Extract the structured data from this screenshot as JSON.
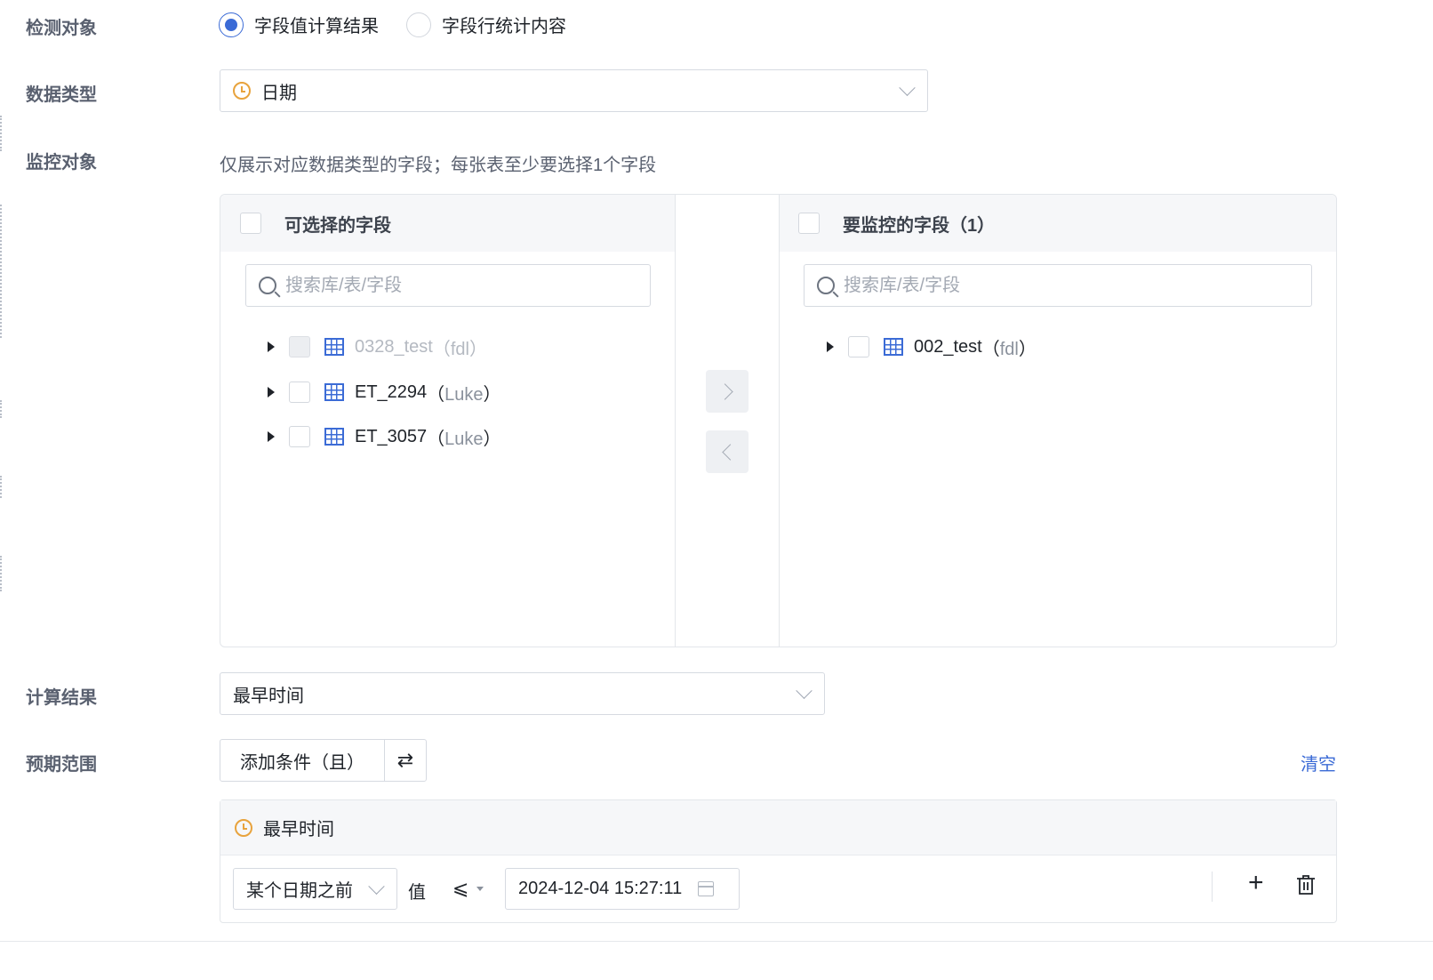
{
  "labels": {
    "detect_target": "检测对象",
    "data_type": "数据类型",
    "monitor_target": "监控对象",
    "calc_result": "计算结果",
    "expected_range": "预期范围"
  },
  "detect_options": [
    {
      "label": "字段值计算结果",
      "selected": true
    },
    {
      "label": "字段行统计内容",
      "selected": false
    }
  ],
  "data_type": {
    "value": "日期",
    "icon": "clock-icon"
  },
  "monitor": {
    "hint": "仅展示对应数据类型的字段；每张表至少要选择1个字段",
    "left_panel": {
      "title": "可选择的字段",
      "search_placeholder": "搜索库/表/字段",
      "items": [
        {
          "name": "0328_test",
          "owner_open": "（",
          "owner": "fdl",
          "owner_close": "）",
          "disabled": true
        },
        {
          "name": "ET_2294",
          "owner_open": "（",
          "owner": "Luke",
          "owner_close": "）",
          "disabled": false
        },
        {
          "name": "ET_3057",
          "owner_open": "（",
          "owner": "Luke",
          "owner_close": "）",
          "disabled": false
        }
      ]
    },
    "right_panel": {
      "title": "要监控的字段（1）",
      "search_placeholder": "搜索库/表/字段",
      "items": [
        {
          "name": "002_test",
          "owner_open": "（",
          "owner": "fdl",
          "owner_close": "）",
          "disabled": false
        }
      ]
    }
  },
  "calc_result": {
    "value": "最早时间"
  },
  "expected": {
    "add_condition": "添加条件（且）",
    "swap_symbol": "⇄",
    "clear": "清空",
    "condition": {
      "title": "最早时间",
      "type": "某个日期之前",
      "value_label": "值",
      "operator": "⩽",
      "date": "2024-12-04 15:27:11",
      "add_symbol": "+",
      "delete_icon": "trash-icon"
    }
  },
  "colors": {
    "accent": "#3b6bd6",
    "clock": "#e8a33d"
  }
}
